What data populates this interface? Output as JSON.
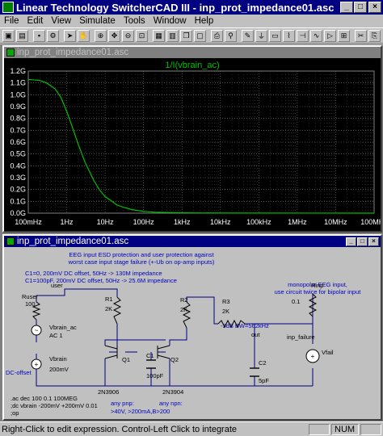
{
  "window": {
    "title": "Linear Technology SwitcherCAD III - inp_prot_impedance01.asc",
    "minimize": "_",
    "maximize": "□",
    "close": "×"
  },
  "menu": [
    "File",
    "Edit",
    "View",
    "Simulate",
    "Tools",
    "Window",
    "Help"
  ],
  "plot_window": {
    "title": "inp_prot_impedance01.asc",
    "trace_label": "1/I(vbrain_ac)",
    "trace_color": "#00c000"
  },
  "chart_data": {
    "type": "line",
    "title": "1/I(vbrain_ac)",
    "x_scale": "log",
    "xlim": [
      0.1,
      100000000
    ],
    "ylim": [
      0.0,
      1.2
    ],
    "x_tick_labels": [
      "100mHz",
      "1Hz",
      "10Hz",
      "100Hz",
      "1kHz",
      "10kHz",
      "100kHz",
      "1MHz",
      "10MHz",
      "100MHz"
    ],
    "y_tick_labels": [
      "1.2G",
      "1.1G",
      "1.0G",
      "0.9G",
      "0.8G",
      "0.7G",
      "0.6G",
      "0.5G",
      "0.4G",
      "0.3G",
      "0.2G",
      "0.1G",
      "0.0G"
    ],
    "y_unit": "G",
    "series": [
      {
        "name": "1/I(vbrain_ac)",
        "x": [
          0.1,
          0.2,
          0.3,
          0.5,
          0.7,
          1,
          1.5,
          2,
          3,
          5,
          7,
          10,
          15,
          20,
          30,
          50,
          100,
          200,
          1000,
          10000,
          100000000
        ],
        "y": [
          1.13,
          1.12,
          1.1,
          1.05,
          0.98,
          0.86,
          0.7,
          0.58,
          0.43,
          0.28,
          0.2,
          0.14,
          0.1,
          0.07,
          0.05,
          0.03,
          0.015,
          0.008,
          0.003,
          0.001,
          0.0
        ]
      }
    ],
    "grid": true,
    "background": "#000000"
  },
  "schematic_window": {
    "title": "inp_prot_impedance01.asc",
    "notes": {
      "header1": "EEG input ESD protection and user protection against",
      "header2": "worst case input stage failure (+-Ub on op-amp inputs)",
      "c1_a": "C1=0, 200mV DC offset, 50Hz -> 130M impedance",
      "c1_b": "C1=100pF, 200mV DC offset, 50Hz -> 25.6M impedance",
      "mono1": "monopolar EEG input,",
      "mono2": "use circuit twice for bipolar input",
      "bw": "-3dB BW=562kHz",
      "pnp": "any pnp:",
      "npn": "any npn:",
      "limits": ">40V, >200mA,B>200",
      "ac_cmd": ".ac dec 100 0.1 100MEG",
      "dc_cmd": ";dc vbrain -200mV +200mV 0.01",
      "op_cmd": ";op"
    },
    "labels": {
      "ruser": "Ruser",
      "ruser_val": "100",
      "user": "user",
      "r1": "R1",
      "r1_val": "2K",
      "r2": "R2",
      "r2_val": "2K",
      "r3": "R3",
      "r3_val": "2K",
      "out": "out",
      "rinp": "Rinp",
      "rinp_val": "0.1",
      "inp_failure": "inp_failure",
      "vfail": "Vfail",
      "vbrain_ac": "Vbrain_ac",
      "vbrain_ac_val": "AC 1",
      "vbrain": "Vbrain",
      "vbrain_val": "200mV",
      "dc_offset": "DC-offset",
      "q1": "Q1",
      "q1_part": "2N3906",
      "q2": "Q2",
      "q2_part": "2N3904",
      "c1": "C1",
      "c1_val": "100pF",
      "c2": "C2",
      "c2_val": "5pF"
    }
  },
  "status": {
    "message": "Right-Click to edit expression. Control-Left Click to integrate",
    "num": "NUM"
  }
}
